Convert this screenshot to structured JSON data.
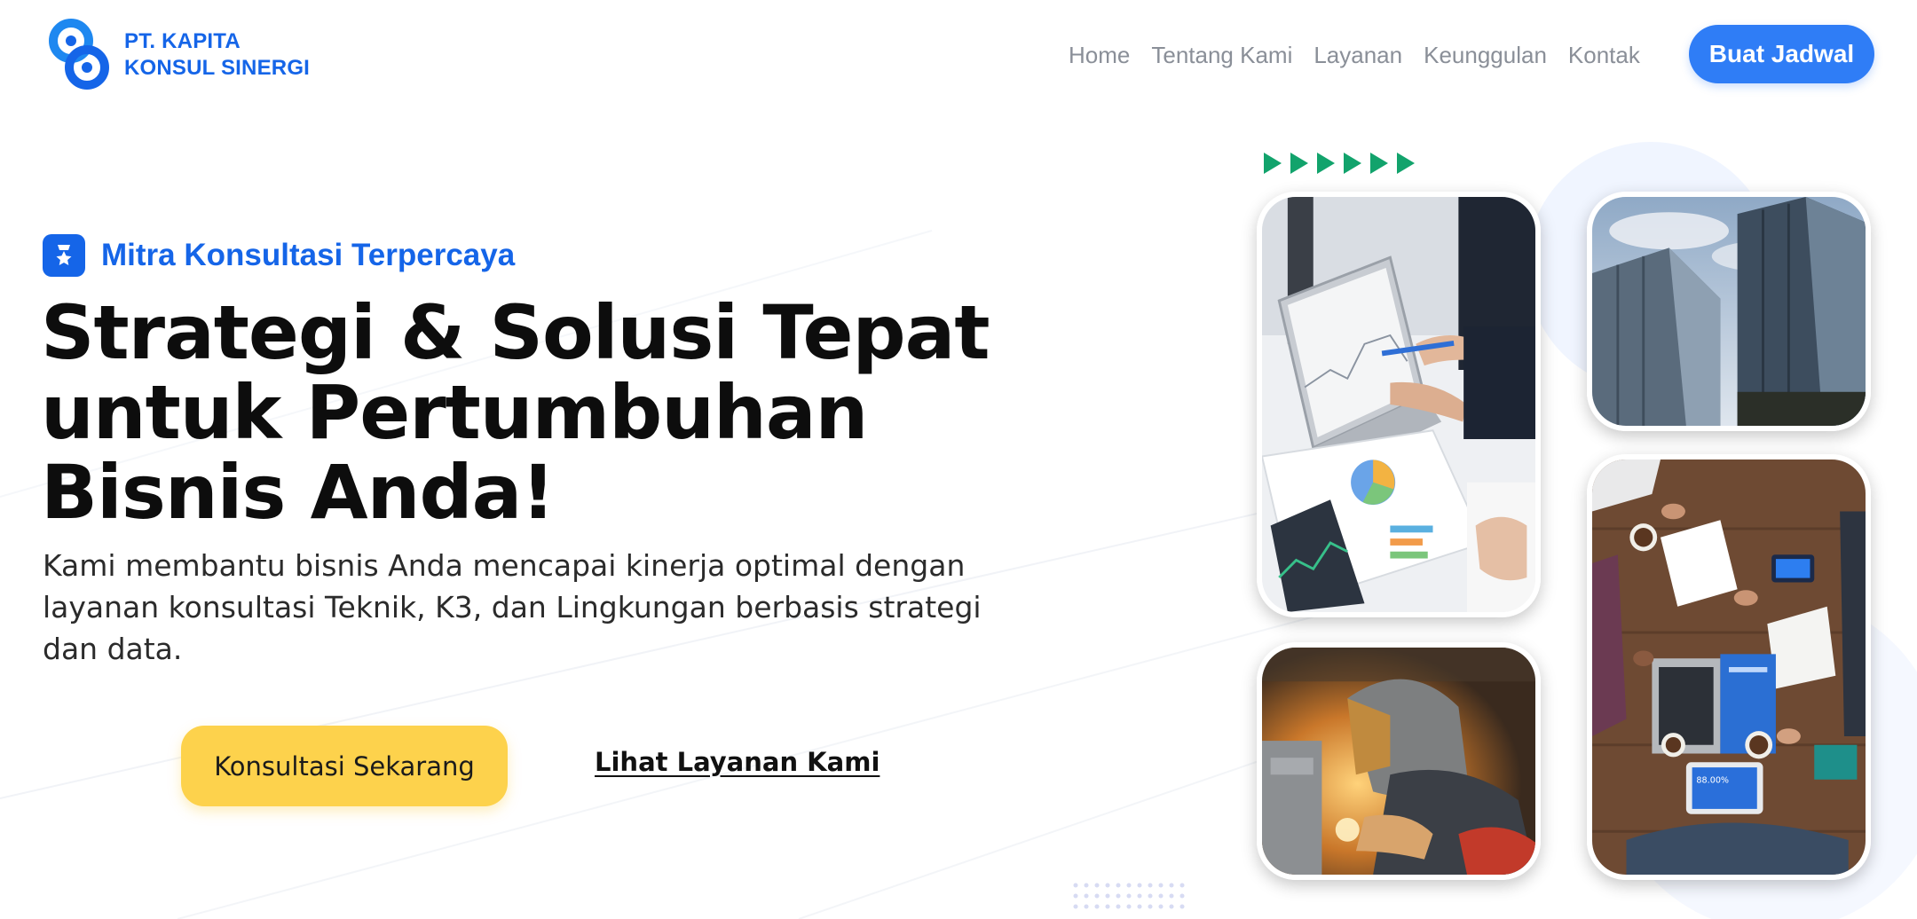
{
  "brand": {
    "line1": "PT. KAPITA",
    "line2": "KONSUL SINERGI",
    "logo_icon": "interlocking-circles-logo",
    "color": "#1565e8"
  },
  "nav": {
    "items": [
      {
        "label": "Home"
      },
      {
        "label": "Tentang Kami"
      },
      {
        "label": "Layanan"
      },
      {
        "label": "Keunggulan"
      },
      {
        "label": "Kontak"
      }
    ],
    "cta_label": "Buat Jadwal",
    "cta_color": "#2f7df6"
  },
  "hero": {
    "badge_icon": "award-star-icon",
    "badge_text": "Mitra Konsultasi Terpercaya",
    "title_lines": [
      "Strategi & Solusi Tepat",
      "untuk Pertumbuhan",
      "Bisnis Anda!"
    ],
    "description_lines": [
      "Kami membantu bisnis Anda mencapai kinerja optimal dengan",
      "layanan konsultasi Teknik, K3, dan Lingkungan berbasis strategi",
      "dan data."
    ],
    "primary_button": "Konsultasi Sekarang",
    "primary_color": "#fdd24c",
    "secondary_link": "Lihat Layanan Kami"
  },
  "gallery": {
    "arrow_color": "#12a36c",
    "arrow_count": 6,
    "photo_tablet_value": "88.00%",
    "photos": [
      {
        "name": "business-charts-photo"
      },
      {
        "name": "glass-buildings-photo"
      },
      {
        "name": "welder-photo"
      },
      {
        "name": "team-meeting-photo"
      }
    ]
  }
}
